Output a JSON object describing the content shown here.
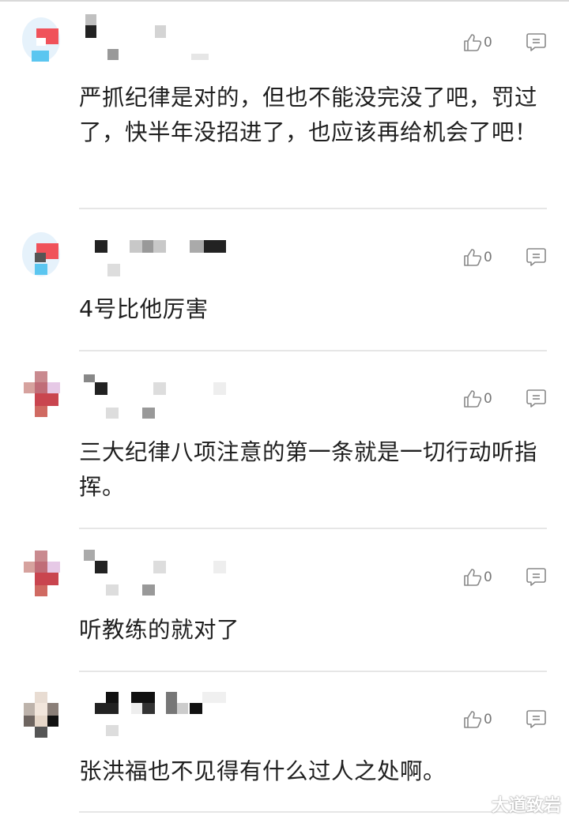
{
  "comments": [
    {
      "text": "严抓纪律是对的，但也不能没完没了吧，罚过了，快半年没招进了，也应该再给机会了吧！",
      "likes": "0",
      "icons": {
        "like": "thumbs-up-icon",
        "reply": "comment-icon"
      }
    },
    {
      "text": "4号比他厉害",
      "likes": "0",
      "icons": {
        "like": "thumbs-up-icon",
        "reply": "comment-icon"
      }
    },
    {
      "text": "三大纪律八项注意的第一条就是一切行动听指挥。",
      "likes": "0",
      "icons": {
        "like": "thumbs-up-icon",
        "reply": "comment-icon"
      }
    },
    {
      "text": "听教练的就对了",
      "likes": "0",
      "icons": {
        "like": "thumbs-up-icon",
        "reply": "comment-icon"
      }
    },
    {
      "text": "张洪福也不见得有什么过人之处啊。",
      "likes": "0",
      "icons": {
        "like": "thumbs-up-icon",
        "reply": "comment-icon"
      }
    }
  ],
  "watermark": "大道致岩",
  "colors": {
    "text": "#1f1f1f",
    "icon": "#888888",
    "divider": "#e6e6e6"
  }
}
